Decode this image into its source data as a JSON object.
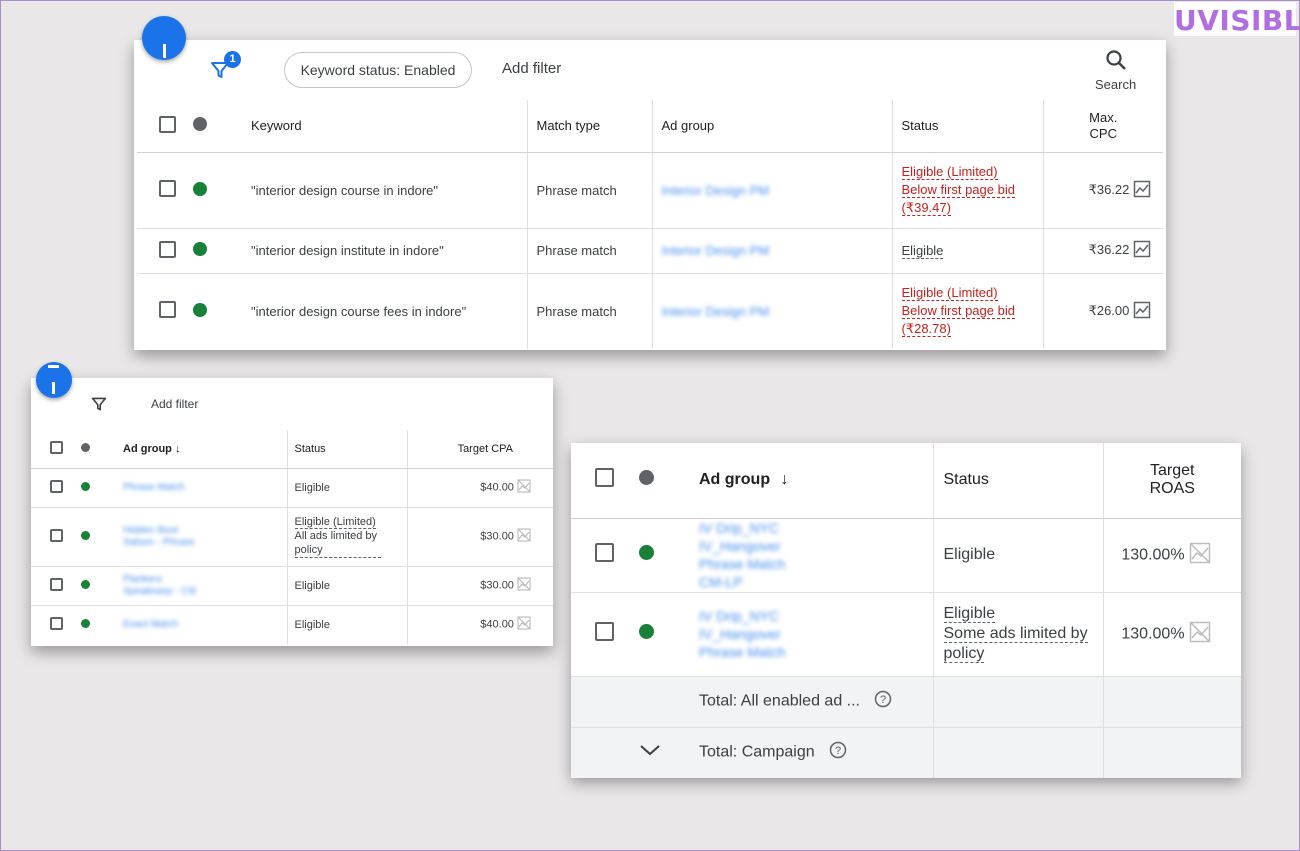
{
  "brand": {
    "logo_text": "UVISIBLE"
  },
  "keyword_panel": {
    "filter_badge": "1",
    "status_chip": "Keyword status: Enabled",
    "add_filter": "Add filter",
    "search_label": "Search",
    "columns": {
      "keyword": "Keyword",
      "match_type": "Match type",
      "ad_group": "Ad group",
      "status": "Status",
      "max_cpc": "Max. CPC"
    },
    "rows": [
      {
        "keyword": "\"interior design course in indore\"",
        "match_type": "Phrase match",
        "ad_group": "Interior Design PM",
        "status": "Eligible (Limited)",
        "status_detail": "Below first page bid",
        "status_detail2": "(₹39.47)",
        "max_cpc": "₹36.22"
      },
      {
        "keyword": "\"interior design institute in indore\"",
        "match_type": "Phrase match",
        "ad_group": "Interior Design PM",
        "status": "Eligible",
        "max_cpc": "₹36.22"
      },
      {
        "keyword": "\"interior design course fees in indore\"",
        "match_type": "Phrase match",
        "ad_group": "Interior Design PM",
        "status": "Eligible (Limited)",
        "status_detail": "Below first page bid",
        "status_detail2": "(₹28.78)",
        "max_cpc": "₹26.00"
      }
    ]
  },
  "cpa_panel": {
    "add_filter": "Add filter",
    "columns": {
      "ad_group": "Ad group",
      "status": "Status",
      "target_cpa": "Target CPA"
    },
    "rows": [
      {
        "ad_group": "Phrase Match",
        "status": "Eligible",
        "target_cpa": "$40.00"
      },
      {
        "ad_group": "Hidden Boot Saloon - Phrase",
        "status": "Eligible (Limited)",
        "status_detail": "All ads limited by policy",
        "target_cpa": "$30.00"
      },
      {
        "ad_group": "Plankers Speakeasy - Ctil",
        "status": "Eligible",
        "target_cpa": "$30.00"
      },
      {
        "ad_group": "Exact Match",
        "status": "Eligible",
        "target_cpa": "$40.00"
      }
    ]
  },
  "roas_panel": {
    "columns": {
      "ad_group": "Ad group",
      "status": "Status",
      "target_roas": "Target ROAS"
    },
    "rows": [
      {
        "ad_group": "IV Drip_NYC IV_Hangover Phrase Match CM-LP",
        "status": "Eligible",
        "target_roas": "130.00%"
      },
      {
        "ad_group": "IV Drip_NYC IV_Hangover Phrase Match",
        "status": "Eligible",
        "status_detail": "Some ads limited by policy",
        "target_roas": "130.00%"
      }
    ],
    "totals": [
      {
        "label": "Total: All enabled ad ..."
      },
      {
        "label": "Total: Campaign"
      }
    ]
  }
}
